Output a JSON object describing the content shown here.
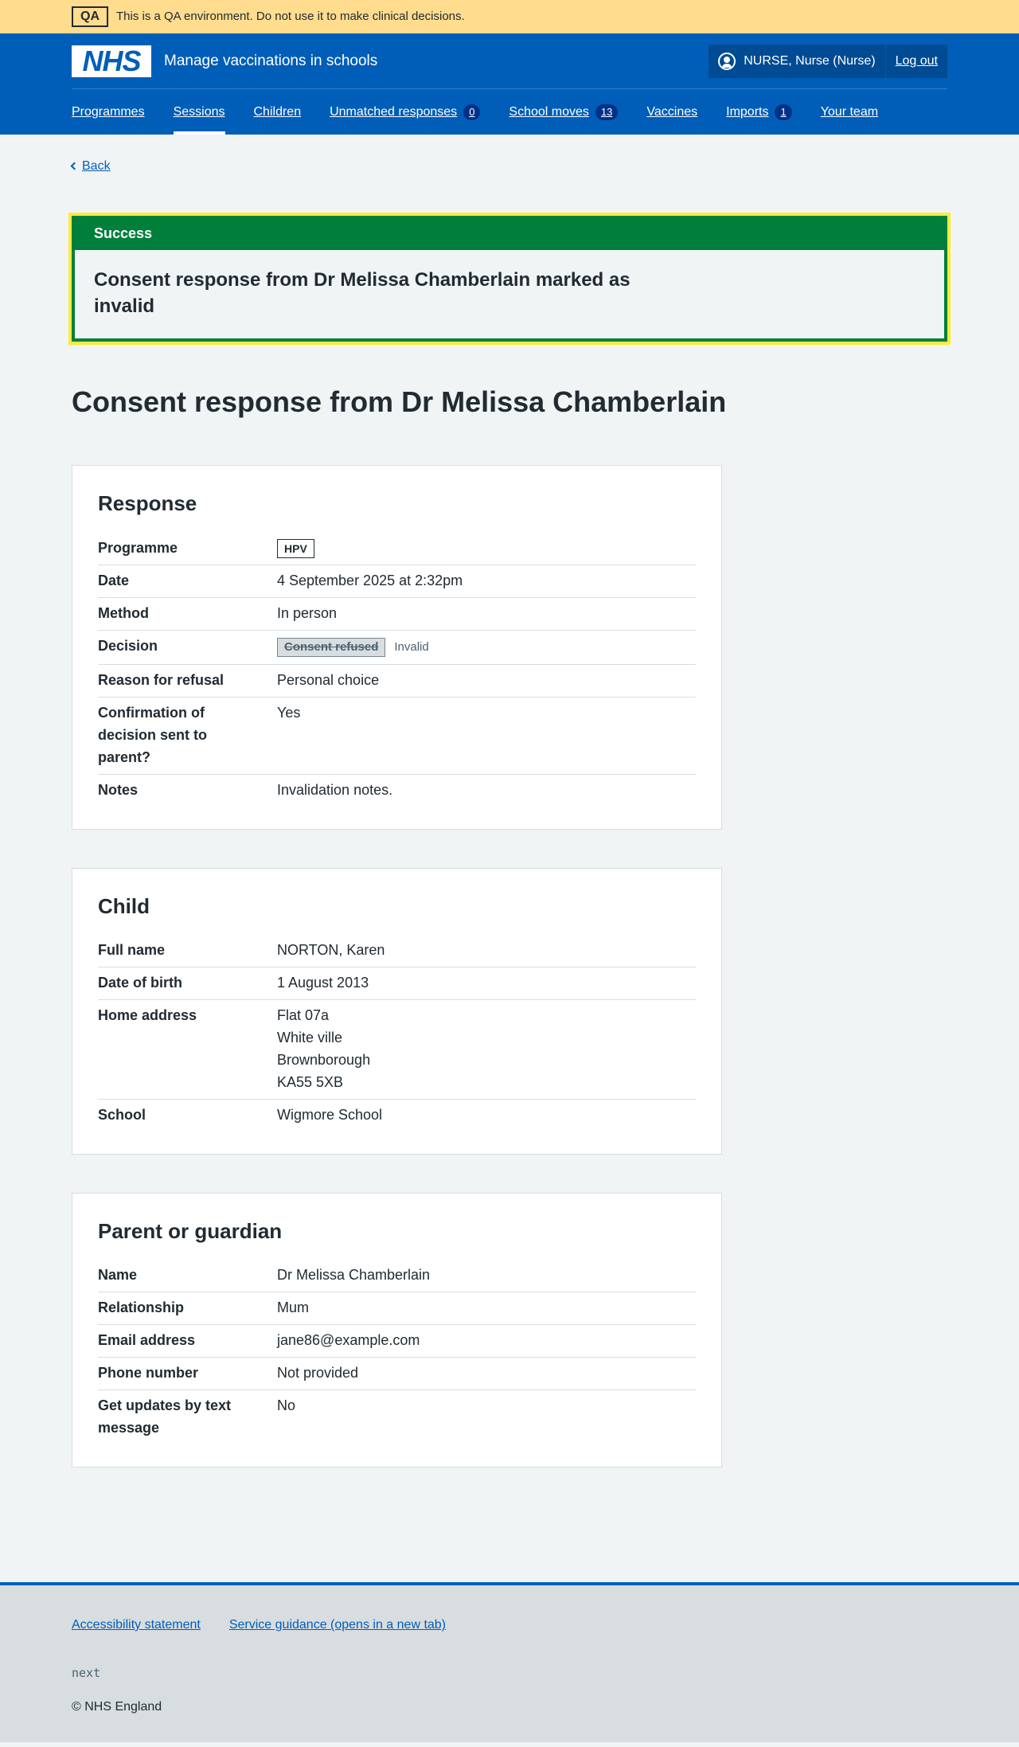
{
  "qa": {
    "tag": "QA",
    "message": "This is a QA environment. Do not use it to make clinical decisions."
  },
  "header": {
    "logo": "NHS",
    "service_name": "Manage vaccinations in schools",
    "user": "NURSE, Nurse (Nurse)",
    "logout": "Log out"
  },
  "nav": {
    "programmes": "Programmes",
    "sessions": "Sessions",
    "children": "Children",
    "unmatched": "Unmatched responses",
    "unmatched_count": "0",
    "school_moves": "School moves",
    "school_moves_count": "13",
    "vaccines": "Vaccines",
    "imports": "Imports",
    "imports_count": "1",
    "team": "Your team"
  },
  "back": "Back",
  "success": {
    "heading": "Success",
    "message": "Consent response from Dr Melissa Chamberlain marked as invalid"
  },
  "title": "Consent response from Dr Melissa Chamberlain",
  "response": {
    "heading": "Response",
    "programme_label": "Programme",
    "programme_value": "HPV",
    "date_label": "Date",
    "date_value": "4 September 2025 at 2:32pm",
    "method_label": "Method",
    "method_value": "In person",
    "decision_label": "Decision",
    "decision_value": "Consent refused",
    "decision_status": "Invalid",
    "reason_label": "Reason for refusal",
    "reason_value": "Personal choice",
    "confirmation_label": "Confirmation of decision sent to parent?",
    "confirmation_value": "Yes",
    "notes_label": "Notes",
    "notes_value": "Invalidation notes."
  },
  "child": {
    "heading": "Child",
    "name_label": "Full name",
    "name_value": "NORTON, Karen",
    "dob_label": "Date of birth",
    "dob_value": "1 August 2013",
    "address_label": "Home address",
    "address_line1": "Flat 07a",
    "address_line2": "White ville",
    "address_line3": "Brownborough",
    "address_line4": "KA55 5XB",
    "school_label": "School",
    "school_value": "Wigmore School"
  },
  "parent": {
    "heading": "Parent or guardian",
    "name_label": "Name",
    "name_value": "Dr Melissa Chamberlain",
    "relationship_label": "Relationship",
    "relationship_value": "Mum",
    "email_label": "Email address",
    "email_value": "jane86@example.com",
    "phone_label": "Phone number",
    "phone_value": "Not provided",
    "updates_label": "Get updates by text message",
    "updates_value": "No"
  },
  "footer": {
    "accessibility": "Accessibility statement",
    "guidance": "Service guidance (opens in a new tab)",
    "version": "next",
    "copyright": "© NHS England"
  },
  "colors": {
    "brand": "#005eb8",
    "success": "#007f3b",
    "qa_banner": "#ffdc8e",
    "focus": "#ffeb3b"
  }
}
